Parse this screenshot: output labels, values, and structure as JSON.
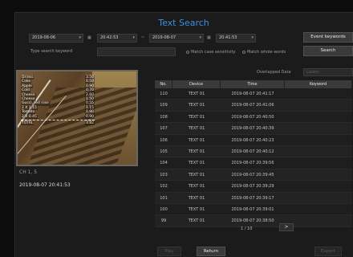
{
  "title": "Text Search",
  "search": {
    "start_date": "2019-08-06",
    "start_time": "20:42:53",
    "range_separator": "~",
    "end_date": "2019-08-07",
    "end_time": "20:41:53",
    "keyword_label": "Type search keyword",
    "keyword_value": "",
    "match_case_label": "Match case sensitivity",
    "match_whole_label": "Match whole words",
    "event_keywords_label": "Event keywords",
    "search_label": "Search",
    "overlapped_label": "Overlapped Data",
    "overlapped_value": "Latest"
  },
  "preview": {
    "receipt": [
      {
        "item": "Drinks",
        "price": "3.50"
      },
      {
        "item": "Coke",
        "price": "0.50"
      },
      {
        "item": "Apple",
        "price": "0.90"
      },
      {
        "item": "Cold",
        "price": "0.70"
      },
      {
        "item": "Cheese",
        "price": "2.60"
      },
      {
        "item": "Cheese",
        "price": "1.50"
      },
      {
        "item": "Gucci, red rose",
        "price": "0.55"
      },
      {
        "item": "2 X 1.15",
        "price": "1.15"
      },
      {
        "item": "Tomato",
        "price": "0.90"
      },
      {
        "item": "2 X 0.45",
        "price": "0.90"
      }
    ],
    "total_label": "TOTAL",
    "total_value": "3.82"
  },
  "channel_label": "CH 1, 5",
  "datetime_label": "2019-08-07  20:41:53",
  "table": {
    "headers": [
      "No.",
      "Device",
      "Time",
      "Keyword"
    ],
    "rows": [
      {
        "no": "110",
        "device": "TEXT 01",
        "time": "2019-08-07  20:41:17",
        "keyword": ""
      },
      {
        "no": "109",
        "device": "TEXT 01",
        "time": "2019-08-07  20:41:06",
        "keyword": ""
      },
      {
        "no": "108",
        "device": "TEXT 01",
        "time": "2019-08-07  20:40:50",
        "keyword": ""
      },
      {
        "no": "107",
        "device": "TEXT 01",
        "time": "2019-08-07  20:40:39",
        "keyword": ""
      },
      {
        "no": "106",
        "device": "TEXT 01",
        "time": "2019-08-07  20:40:23",
        "keyword": ""
      },
      {
        "no": "105",
        "device": "TEXT 01",
        "time": "2019-08-07  20:40:12",
        "keyword": ""
      },
      {
        "no": "104",
        "device": "TEXT 01",
        "time": "2019-08-07  20:39:56",
        "keyword": ""
      },
      {
        "no": "103",
        "device": "TEXT 01",
        "time": "2019-08-07  20:39:45",
        "keyword": ""
      },
      {
        "no": "102",
        "device": "TEXT 01",
        "time": "2019-08-07  20:39:29",
        "keyword": ""
      },
      {
        "no": "101",
        "device": "TEXT 01",
        "time": "2019-08-07  20:39:17",
        "keyword": ""
      },
      {
        "no": "100",
        "device": "TEXT 01",
        "time": "2019-08-07  20:39:01",
        "keyword": ""
      },
      {
        "no": "99",
        "device": "TEXT 01",
        "time": "2019-08-07  20:38:50",
        "keyword": ""
      }
    ]
  },
  "pager": {
    "page": "1 / 10",
    "next_label": ">"
  },
  "footer": {
    "play_label": "Play",
    "return_label": "Return",
    "export_label": "Export"
  }
}
